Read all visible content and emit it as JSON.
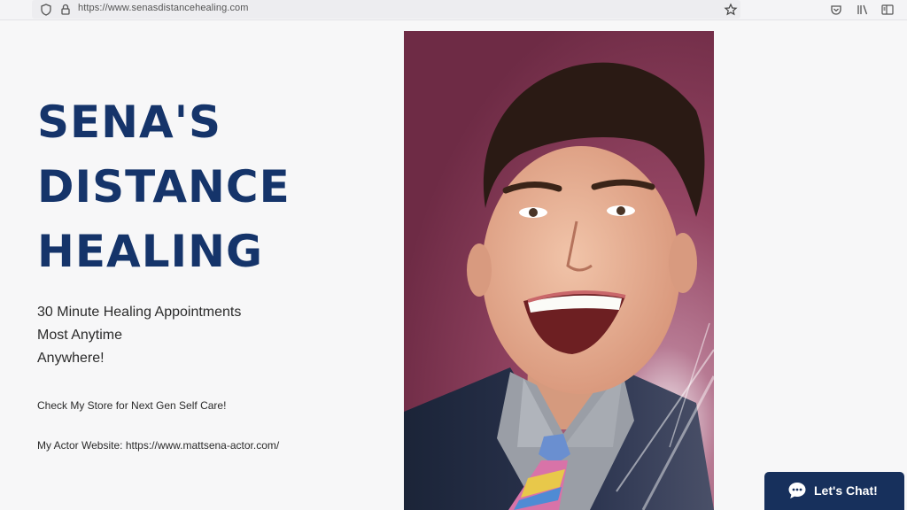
{
  "browser": {
    "url": "https://www.senasdistancehealing.com",
    "icons": [
      "shield-icon",
      "lock-icon",
      "bookmark-star-icon",
      "pocket-icon",
      "library-icon",
      "sidebar-icon"
    ]
  },
  "hero": {
    "title_lines": [
      "SENA'S",
      "DISTANCE",
      "HEALING"
    ],
    "subtitle_lines": [
      "30 Minute Healing Appointments",
      "Most Anytime",
      "Anywhere!"
    ],
    "store_text": "Check My Store for Next Gen Self Care!",
    "actor_prefix": "My Actor Website: ",
    "actor_link": "https://www.mattsena-actor.com/"
  },
  "chat": {
    "label": "Let's Chat!",
    "icon": "chat-bubble-icon"
  },
  "colors": {
    "title": "#15346a",
    "chat_bg": "#17305c",
    "page_bg": "#f7f7f8",
    "portrait_bg": "#8e3f5c"
  }
}
